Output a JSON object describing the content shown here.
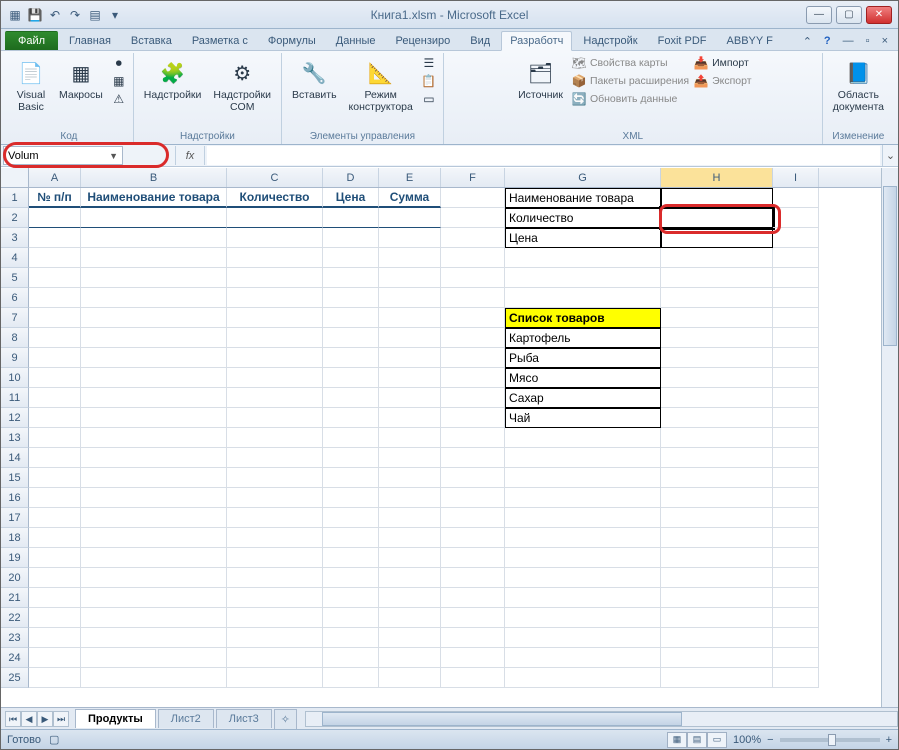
{
  "title": "Книга1.xlsm - Microsoft Excel",
  "tabs": {
    "file": "Файл",
    "items": [
      "Главная",
      "Вставка",
      "Разметка с",
      "Формулы",
      "Данные",
      "Рецензиро",
      "Вид",
      "Разработч",
      "Надстройк",
      "Foxit PDF",
      "ABBYY F"
    ]
  },
  "ribbon": {
    "code": {
      "vb": "Visual\nBasic",
      "macros": "Макросы",
      "label": "Код"
    },
    "addins": {
      "addins": "Надстройки",
      "com": "Надстройки\nCOM",
      "label": "Надстройки"
    },
    "controls": {
      "insert": "Вставить",
      "design": "Режим\nконструктора",
      "label": "Элементы управления"
    },
    "xml": {
      "source": "Источник",
      "map_props": "Свойства карты",
      "ext_packs": "Пакеты расширения",
      "refresh": "Обновить данные",
      "import": "Импорт",
      "export": "Экспорт",
      "label": "XML"
    },
    "modify": {
      "doc_area": "Область\nдокумента",
      "label": "Изменение"
    }
  },
  "name_box": "Volum",
  "fx_label": "fx",
  "columns": [
    "A",
    "B",
    "C",
    "D",
    "E",
    "F",
    "G",
    "H",
    "I"
  ],
  "table_headers": {
    "A": "№ п/п",
    "B": "Наименование товара",
    "C": "Количество",
    "D": "Цена",
    "E": "Сумма"
  },
  "right_block": {
    "r1": "Наименование товара",
    "r2": "Количество",
    "r3": "Цена"
  },
  "product_list": {
    "title": "Список товаров",
    "items": [
      "Картофель",
      "Рыба",
      "Мясо",
      "Сахар",
      "Чай"
    ]
  },
  "sheet_tabs": {
    "active": "Продукты",
    "others": [
      "Лист2",
      "Лист3"
    ]
  },
  "status": {
    "ready": "Готово",
    "zoom": "100%"
  }
}
